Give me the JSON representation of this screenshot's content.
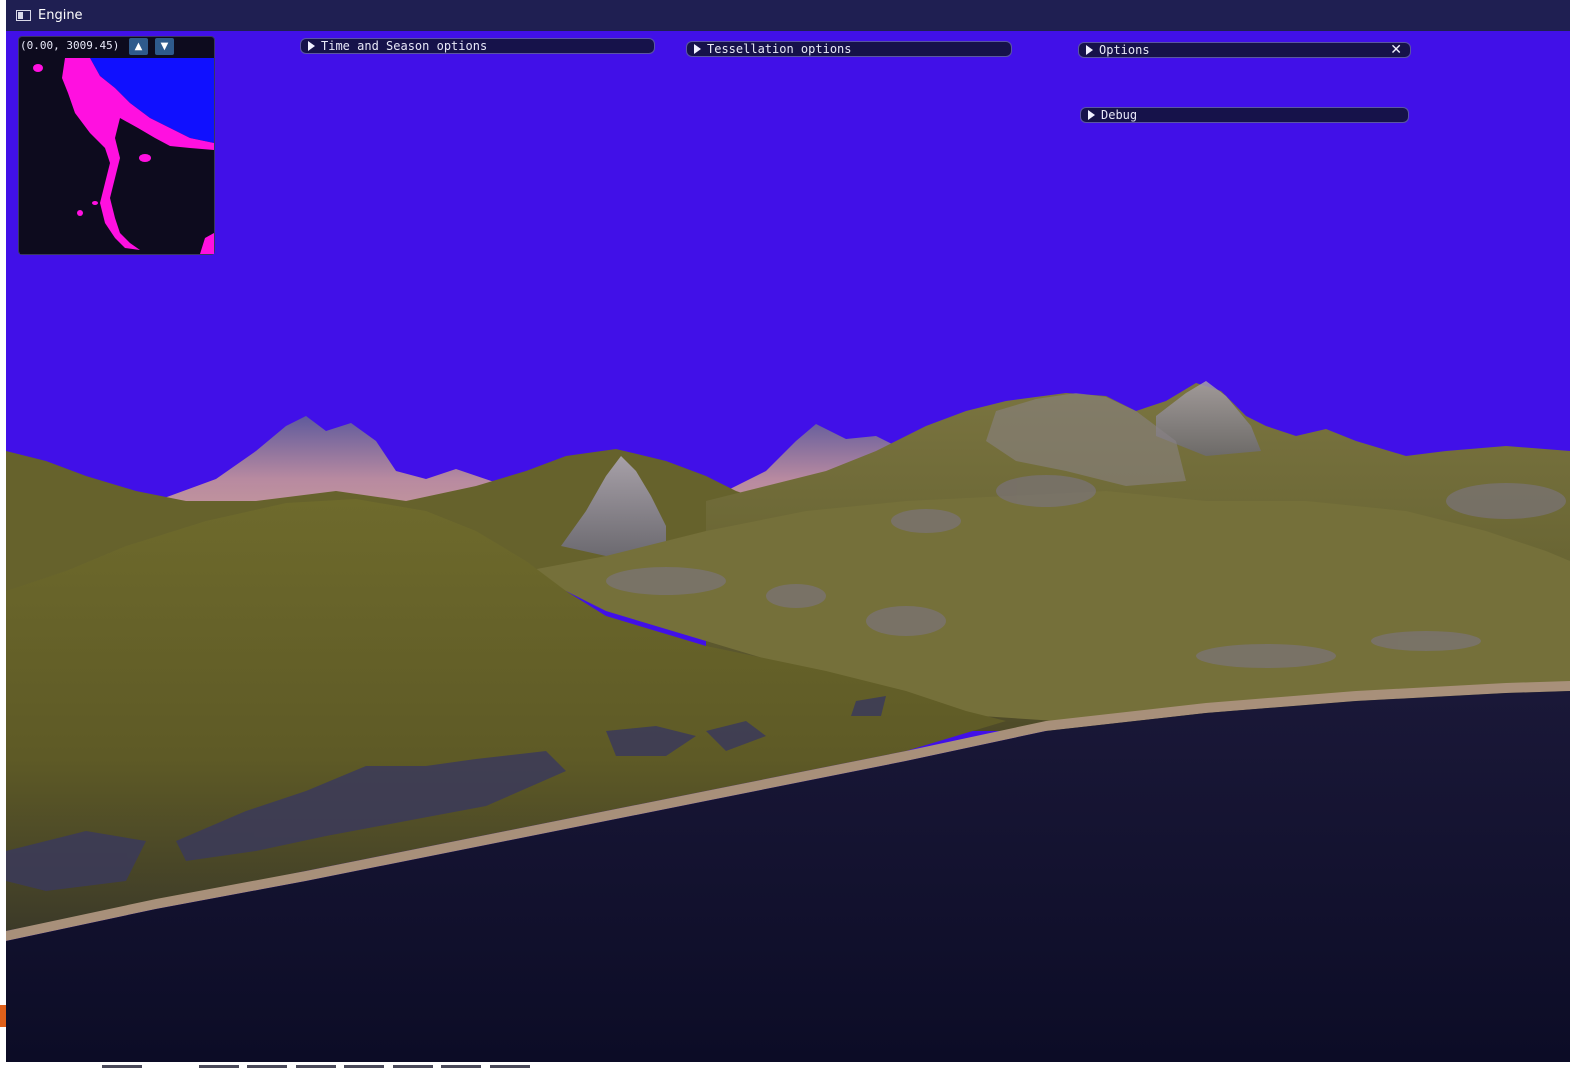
{
  "window": {
    "title": "Engine"
  },
  "minimap": {
    "coords": "(0.00, 3009.45)",
    "up_icon": "up-arrow-icon",
    "down_icon": "down-arrow-icon"
  },
  "panels": {
    "time_season": {
      "label": "Time and Season options",
      "icon": "triangle-right-icon"
    },
    "tessellation": {
      "label": "Tessellation options",
      "icon": "triangle-right-icon"
    },
    "options": {
      "label": "Options",
      "icon": "triangle-right-icon",
      "close_icon": "close-icon"
    },
    "debug": {
      "label": "Debug",
      "icon": "triangle-right-icon"
    }
  },
  "colors": {
    "sky": "#4110e8",
    "titlebar": "#1f1f52",
    "panel_bg": "#16124a",
    "panel_border": "#5a56a2",
    "grass": "#6b6628",
    "rock": "#8a8090",
    "water": "#10102e",
    "sand": "#b09880",
    "minimap_land": "#ff10e0",
    "minimap_water": "#1010ff",
    "minimap_bg": "#0d0b1e"
  }
}
